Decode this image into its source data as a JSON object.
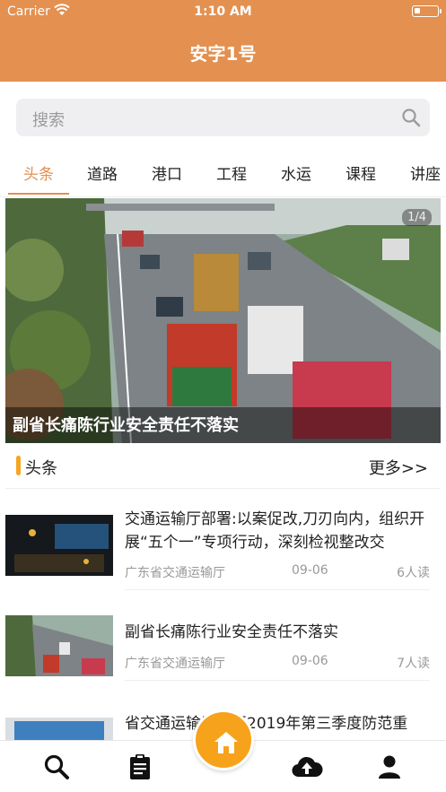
{
  "status_bar": {
    "carrier": "Carrier",
    "time": "1:10 AM"
  },
  "header": {
    "title": "安字1号"
  },
  "search": {
    "placeholder": "搜索"
  },
  "tabs": [
    "头条",
    "道路",
    "港口",
    "工程",
    "水运",
    "课程",
    "讲座"
  ],
  "active_tab": "头条",
  "banner": {
    "counter": "1/4",
    "caption": "副省长痛陈行业安全责任不落实"
  },
  "section": {
    "title": "头条",
    "more": "更多>>"
  },
  "news": [
    {
      "title": "交通运输厅部署:以案促改,刀刃向内，组织开展“五个一”专项行动，深刻检视整改交",
      "source": "广东省交通运输厅",
      "date": "09-06",
      "reads": "6人读"
    },
    {
      "title": "副省长痛陈行业安全责任不落实",
      "source": "广东省交通运输厅",
      "date": "09-06",
      "reads": "7人读"
    },
    {
      "title": "省交通运输厅召开2019年第三季度防范重"
    }
  ],
  "bottom_nav": [
    "search-icon",
    "clipboard-icon",
    "home-icon",
    "cloud-upload-icon",
    "person-icon"
  ],
  "colors": {
    "header": "#E39050",
    "accent": "#E39050",
    "fab": "#F7A21B",
    "section_bar": "#F5A623"
  }
}
